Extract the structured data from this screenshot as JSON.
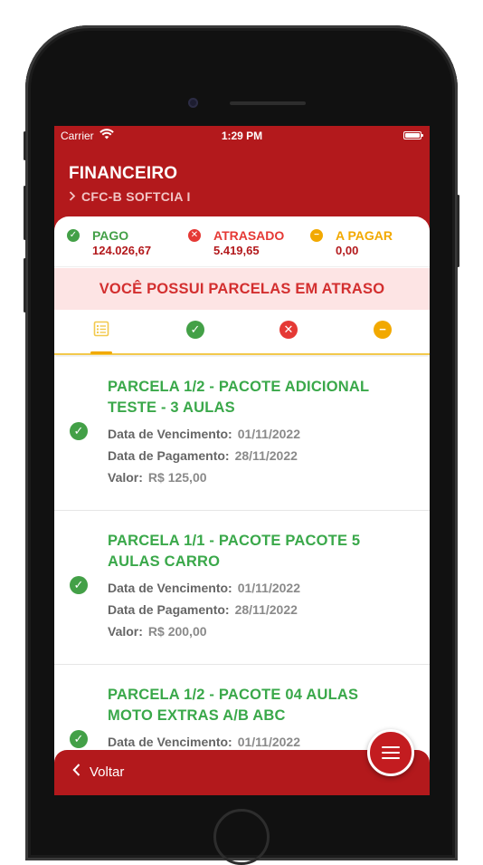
{
  "status_bar": {
    "carrier": "Carrier",
    "time": "1:29 PM"
  },
  "header": {
    "title": "FINANCEIRO",
    "subtitle": "CFC-B SOFTCIA I"
  },
  "summary": [
    {
      "label": "PAGO",
      "value": "124.026,67",
      "color": "#43a047",
      "icon": "check-circle-icon"
    },
    {
      "label": "ATRASADO",
      "value": "5.419,65",
      "color": "#e53935",
      "icon": "x-circle-icon"
    },
    {
      "label": "A PAGAR",
      "value": "0,00",
      "color": "#f2a900",
      "icon": "minus-circle-icon"
    }
  ],
  "alert": "VOCÊ POSSUI PARCELAS EM ATRASO",
  "tabs": [
    {
      "icon": "list-icon",
      "color": "#f2c94c",
      "active": true
    },
    {
      "icon": "check-circle-icon",
      "color": "#43a047"
    },
    {
      "icon": "x-circle-icon",
      "color": "#e53935"
    },
    {
      "icon": "minus-circle-icon",
      "color": "#f2a900"
    }
  ],
  "labels": {
    "due": "Data de Vencimento:",
    "paid": "Data de Pagamento:",
    "value": "Valor:"
  },
  "installments": [
    {
      "title": "PARCELA 1/2 - PACOTE ADICIONAL TESTE - 3 AULAS",
      "due": "01/11/2022",
      "paid": "28/11/2022",
      "value": "R$ 125,00"
    },
    {
      "title": "PARCELA 1/1 - PACOTE PACOTE 5 AULAS CARRO",
      "due": "01/11/2022",
      "paid": "28/11/2022",
      "value": "R$ 200,00"
    },
    {
      "title": "PARCELA 1/2 - PACOTE 04 AULAS MOTO EXTRAS A/B ABC",
      "due": "01/11/2022",
      "paid": "",
      "value": ""
    }
  ],
  "bottom_bar": {
    "back_label": "Voltar"
  }
}
